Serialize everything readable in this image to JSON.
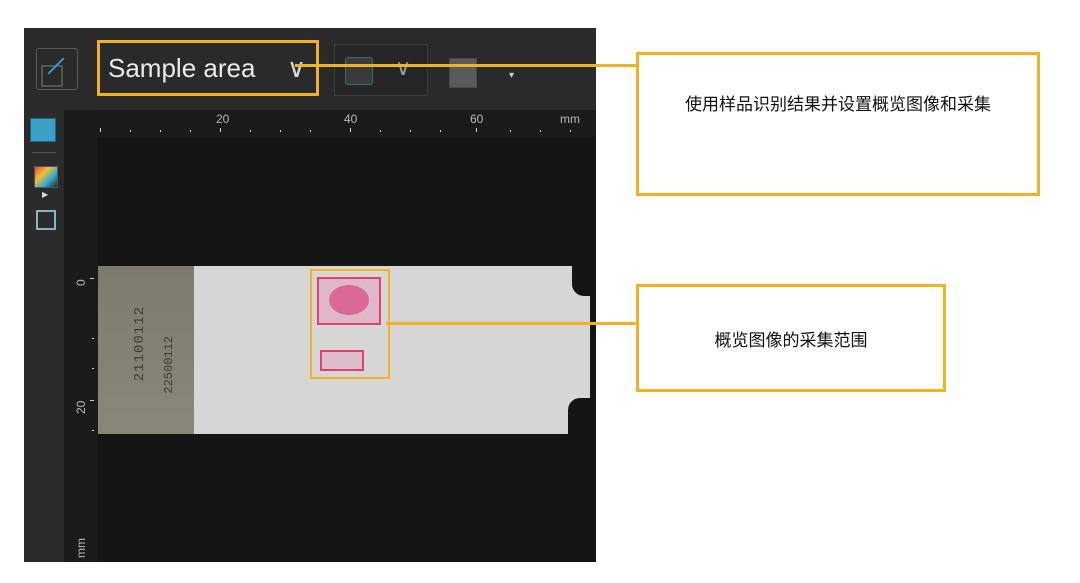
{
  "toolbar": {
    "area_select_label": "Sample area",
    "area_select_icon": "chevron-down-icon"
  },
  "ruler_top": {
    "ticks": [
      "20",
      "40",
      "60",
      "mm"
    ]
  },
  "ruler_left": {
    "ticks": [
      "0",
      "20",
      "mm"
    ]
  },
  "slide_label": {
    "line1": "21100112",
    "line2": "22500112"
  },
  "callouts": {
    "top": "使用样品识别结果并设置概览图像和采集",
    "bottom": "概览图像的采集范围"
  },
  "colors": {
    "highlight": "#f0b323",
    "tissue_outline": "#e5406a",
    "app_bg": "#1b1b1b"
  }
}
